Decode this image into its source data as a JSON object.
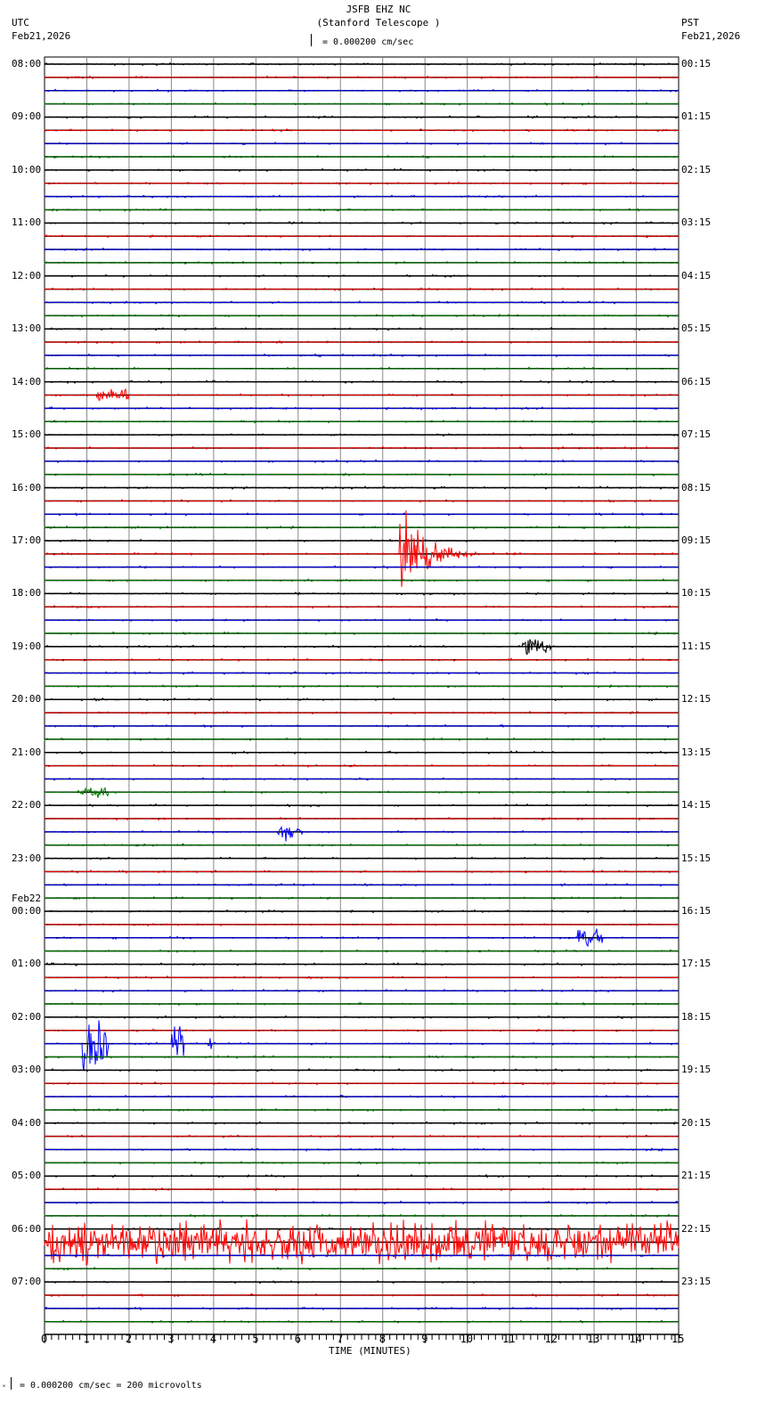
{
  "header": {
    "station": "JSFB EHZ NC",
    "site": "(Stanford Telescope )",
    "scale": "= 0.000200 cm/sec",
    "left_tz": "UTC",
    "left_date": "Feb21,2026",
    "right_tz": "PST",
    "right_date": "Feb21,2026",
    "date_change": "Feb22"
  },
  "footer": {
    "scale_note": "= 0.000200 cm/sec =     200 microvolts"
  },
  "chart_data": {
    "type": "line",
    "title": "JSFB EHZ NC (Stanford Telescope )",
    "xlabel": "TIME (MINUTES)",
    "xlim": [
      0,
      15
    ],
    "x_ticks": [
      "0",
      "1",
      "2",
      "3",
      "4",
      "5",
      "6",
      "7",
      "8",
      "9",
      "10",
      "11",
      "12",
      "13",
      "14",
      "15"
    ],
    "traces_per_hour": 4,
    "trace_colors": [
      "#000000",
      "#ff0000",
      "#0000ff",
      "#008000"
    ],
    "utc_labels": [
      "08:00",
      "09:00",
      "10:00",
      "11:00",
      "12:00",
      "13:00",
      "14:00",
      "15:00",
      "16:00",
      "17:00",
      "18:00",
      "19:00",
      "20:00",
      "21:00",
      "22:00",
      "23:00",
      "00:00",
      "01:00",
      "02:00",
      "03:00",
      "04:00",
      "05:00",
      "06:00",
      "07:00"
    ],
    "pst_labels": [
      "00:15",
      "01:15",
      "02:15",
      "03:15",
      "04:15",
      "05:15",
      "06:15",
      "07:15",
      "08:15",
      "09:15",
      "10:15",
      "11:15",
      "12:15",
      "13:15",
      "14:15",
      "15:15",
      "16:15",
      "17:15",
      "18:15",
      "19:15",
      "20:15",
      "21:15",
      "22:15",
      "23:15"
    ],
    "events": [
      {
        "trace": 37,
        "start_min": 8.4,
        "end_min": 10.3,
        "amplitude": 1.0,
        "label": "earthquake 17:15 UTC"
      },
      {
        "trace": 89,
        "start_min": 0.0,
        "end_min": 15.0,
        "amplitude": 0.35,
        "label": "noisy 06:15 UTC"
      },
      {
        "trace": 74,
        "start_min": 0.9,
        "end_min": 1.5,
        "amplitude": 0.45
      },
      {
        "trace": 74,
        "start_min": 3.0,
        "end_min": 3.3,
        "amplitude": 0.3
      },
      {
        "trace": 74,
        "start_min": 3.85,
        "end_min": 3.95,
        "amplitude": 0.2
      },
      {
        "trace": 44,
        "start_min": 11.3,
        "end_min": 12.0,
        "amplitude": 0.15
      },
      {
        "trace": 25,
        "start_min": 1.2,
        "end_min": 2.0,
        "amplitude": 0.1
      },
      {
        "trace": 58,
        "start_min": 5.5,
        "end_min": 6.1,
        "amplitude": 0.15
      },
      {
        "trace": 66,
        "start_min": 12.6,
        "end_min": 13.2,
        "amplitude": 0.15
      },
      {
        "trace": 55,
        "start_min": 0.8,
        "end_min": 1.5,
        "amplitude": 0.1
      }
    ]
  }
}
